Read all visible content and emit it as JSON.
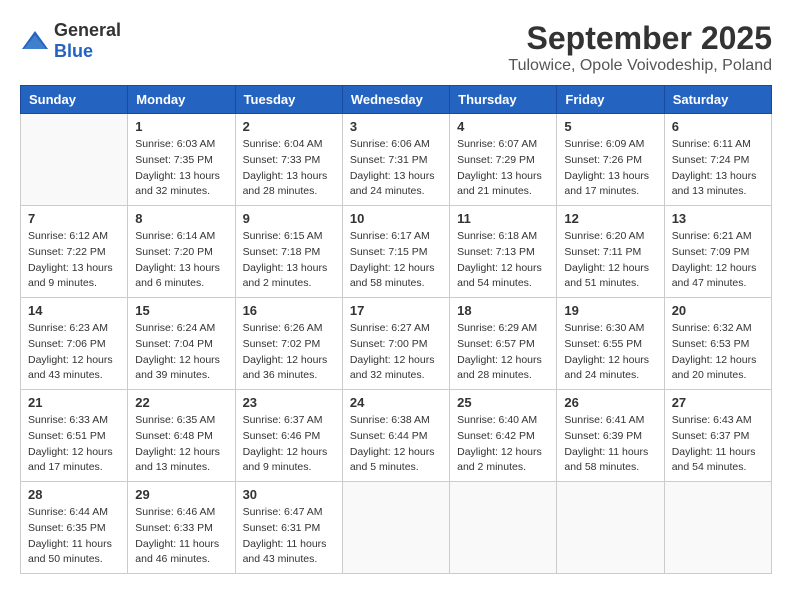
{
  "header": {
    "logo_general": "General",
    "logo_blue": "Blue",
    "month_year": "September 2025",
    "location": "Tulowice, Opole Voivodeship, Poland"
  },
  "weekdays": [
    "Sunday",
    "Monday",
    "Tuesday",
    "Wednesday",
    "Thursday",
    "Friday",
    "Saturday"
  ],
  "weeks": [
    [
      {
        "day": "",
        "sunrise": "",
        "sunset": "",
        "daylight": ""
      },
      {
        "day": "1",
        "sunrise": "Sunrise: 6:03 AM",
        "sunset": "Sunset: 7:35 PM",
        "daylight": "Daylight: 13 hours and 32 minutes."
      },
      {
        "day": "2",
        "sunrise": "Sunrise: 6:04 AM",
        "sunset": "Sunset: 7:33 PM",
        "daylight": "Daylight: 13 hours and 28 minutes."
      },
      {
        "day": "3",
        "sunrise": "Sunrise: 6:06 AM",
        "sunset": "Sunset: 7:31 PM",
        "daylight": "Daylight: 13 hours and 24 minutes."
      },
      {
        "day": "4",
        "sunrise": "Sunrise: 6:07 AM",
        "sunset": "Sunset: 7:29 PM",
        "daylight": "Daylight: 13 hours and 21 minutes."
      },
      {
        "day": "5",
        "sunrise": "Sunrise: 6:09 AM",
        "sunset": "Sunset: 7:26 PM",
        "daylight": "Daylight: 13 hours and 17 minutes."
      },
      {
        "day": "6",
        "sunrise": "Sunrise: 6:11 AM",
        "sunset": "Sunset: 7:24 PM",
        "daylight": "Daylight: 13 hours and 13 minutes."
      }
    ],
    [
      {
        "day": "7",
        "sunrise": "Sunrise: 6:12 AM",
        "sunset": "Sunset: 7:22 PM",
        "daylight": "Daylight: 13 hours and 9 minutes."
      },
      {
        "day": "8",
        "sunrise": "Sunrise: 6:14 AM",
        "sunset": "Sunset: 7:20 PM",
        "daylight": "Daylight: 13 hours and 6 minutes."
      },
      {
        "day": "9",
        "sunrise": "Sunrise: 6:15 AM",
        "sunset": "Sunset: 7:18 PM",
        "daylight": "Daylight: 13 hours and 2 minutes."
      },
      {
        "day": "10",
        "sunrise": "Sunrise: 6:17 AM",
        "sunset": "Sunset: 7:15 PM",
        "daylight": "Daylight: 12 hours and 58 minutes."
      },
      {
        "day": "11",
        "sunrise": "Sunrise: 6:18 AM",
        "sunset": "Sunset: 7:13 PM",
        "daylight": "Daylight: 12 hours and 54 minutes."
      },
      {
        "day": "12",
        "sunrise": "Sunrise: 6:20 AM",
        "sunset": "Sunset: 7:11 PM",
        "daylight": "Daylight: 12 hours and 51 minutes."
      },
      {
        "day": "13",
        "sunrise": "Sunrise: 6:21 AM",
        "sunset": "Sunset: 7:09 PM",
        "daylight": "Daylight: 12 hours and 47 minutes."
      }
    ],
    [
      {
        "day": "14",
        "sunrise": "Sunrise: 6:23 AM",
        "sunset": "Sunset: 7:06 PM",
        "daylight": "Daylight: 12 hours and 43 minutes."
      },
      {
        "day": "15",
        "sunrise": "Sunrise: 6:24 AM",
        "sunset": "Sunset: 7:04 PM",
        "daylight": "Daylight: 12 hours and 39 minutes."
      },
      {
        "day": "16",
        "sunrise": "Sunrise: 6:26 AM",
        "sunset": "Sunset: 7:02 PM",
        "daylight": "Daylight: 12 hours and 36 minutes."
      },
      {
        "day": "17",
        "sunrise": "Sunrise: 6:27 AM",
        "sunset": "Sunset: 7:00 PM",
        "daylight": "Daylight: 12 hours and 32 minutes."
      },
      {
        "day": "18",
        "sunrise": "Sunrise: 6:29 AM",
        "sunset": "Sunset: 6:57 PM",
        "daylight": "Daylight: 12 hours and 28 minutes."
      },
      {
        "day": "19",
        "sunrise": "Sunrise: 6:30 AM",
        "sunset": "Sunset: 6:55 PM",
        "daylight": "Daylight: 12 hours and 24 minutes."
      },
      {
        "day": "20",
        "sunrise": "Sunrise: 6:32 AM",
        "sunset": "Sunset: 6:53 PM",
        "daylight": "Daylight: 12 hours and 20 minutes."
      }
    ],
    [
      {
        "day": "21",
        "sunrise": "Sunrise: 6:33 AM",
        "sunset": "Sunset: 6:51 PM",
        "daylight": "Daylight: 12 hours and 17 minutes."
      },
      {
        "day": "22",
        "sunrise": "Sunrise: 6:35 AM",
        "sunset": "Sunset: 6:48 PM",
        "daylight": "Daylight: 12 hours and 13 minutes."
      },
      {
        "day": "23",
        "sunrise": "Sunrise: 6:37 AM",
        "sunset": "Sunset: 6:46 PM",
        "daylight": "Daylight: 12 hours and 9 minutes."
      },
      {
        "day": "24",
        "sunrise": "Sunrise: 6:38 AM",
        "sunset": "Sunset: 6:44 PM",
        "daylight": "Daylight: 12 hours and 5 minutes."
      },
      {
        "day": "25",
        "sunrise": "Sunrise: 6:40 AM",
        "sunset": "Sunset: 6:42 PM",
        "daylight": "Daylight: 12 hours and 2 minutes."
      },
      {
        "day": "26",
        "sunrise": "Sunrise: 6:41 AM",
        "sunset": "Sunset: 6:39 PM",
        "daylight": "Daylight: 11 hours and 58 minutes."
      },
      {
        "day": "27",
        "sunrise": "Sunrise: 6:43 AM",
        "sunset": "Sunset: 6:37 PM",
        "daylight": "Daylight: 11 hours and 54 minutes."
      }
    ],
    [
      {
        "day": "28",
        "sunrise": "Sunrise: 6:44 AM",
        "sunset": "Sunset: 6:35 PM",
        "daylight": "Daylight: 11 hours and 50 minutes."
      },
      {
        "day": "29",
        "sunrise": "Sunrise: 6:46 AM",
        "sunset": "Sunset: 6:33 PM",
        "daylight": "Daylight: 11 hours and 46 minutes."
      },
      {
        "day": "30",
        "sunrise": "Sunrise: 6:47 AM",
        "sunset": "Sunset: 6:31 PM",
        "daylight": "Daylight: 11 hours and 43 minutes."
      },
      {
        "day": "",
        "sunrise": "",
        "sunset": "",
        "daylight": ""
      },
      {
        "day": "",
        "sunrise": "",
        "sunset": "",
        "daylight": ""
      },
      {
        "day": "",
        "sunrise": "",
        "sunset": "",
        "daylight": ""
      },
      {
        "day": "",
        "sunrise": "",
        "sunset": "",
        "daylight": ""
      }
    ]
  ]
}
